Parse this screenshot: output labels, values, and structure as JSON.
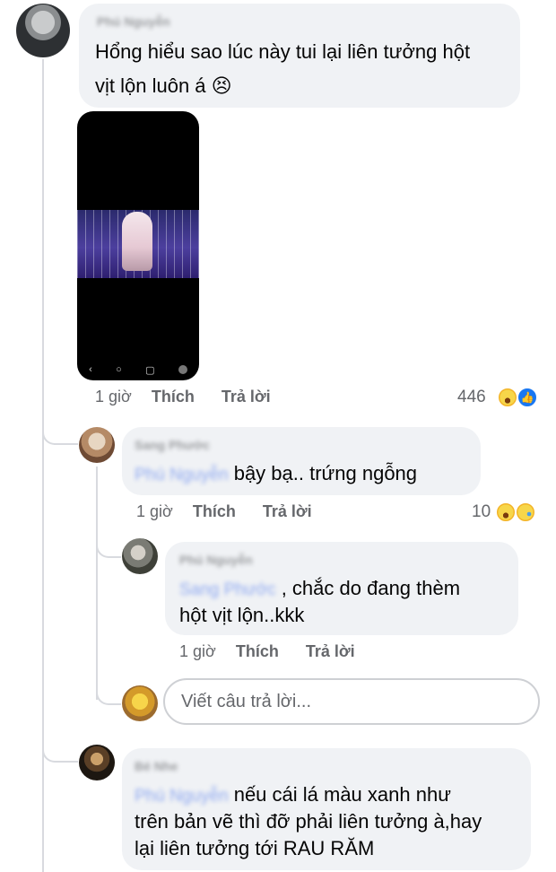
{
  "comments": [
    {
      "author": "Phú Nguyễn",
      "text_line1": "Hổng hiểu sao lúc này tui lại liên tưởng hột",
      "text_line2": "vịt lộn luôn á 😣",
      "time": "1 giờ",
      "like_label": "Thích",
      "reply_label": "Trả lời",
      "reaction_count": "446",
      "reactions": [
        "haha-icon",
        "like-icon"
      ]
    },
    {
      "author": "Sang Phước",
      "mention": "Phú Nguyễn",
      "text": "bậy bạ.. trứng ngỗng",
      "time": "1 giờ",
      "like_label": "Thích",
      "reply_label": "Trả lời",
      "reaction_count": "10",
      "reactions": [
        "haha-icon",
        "sad-icon"
      ]
    },
    {
      "author": "Phú Nguyễn",
      "mention": "Sang Phước",
      "text_line1": ", chắc do đang thèm",
      "text_line2": "hột vịt lộn..kkk",
      "time": "1 giờ",
      "like_label": "Thích",
      "reply_label": "Trả lời"
    },
    {
      "author": "Bé Nhe",
      "mention": "Phú Nguyễn",
      "text_line1": "nếu cái lá màu xanh như",
      "text_line2": "trên bản vẽ thì đỡ phải liên tưởng à,hay",
      "text_line3": "lại liên tưởng tới RAU RĂM"
    }
  ],
  "reply_box": {
    "placeholder": "Viết câu trả lời..."
  },
  "video": {
    "nav_back": "‹",
    "nav_home": "○",
    "nav_recent": "▢"
  },
  "colors": {
    "bubble": "#f0f2f5",
    "meta_text": "#65676b",
    "like_blue": "#1877f2",
    "haha_yellow": "#f7b125"
  }
}
